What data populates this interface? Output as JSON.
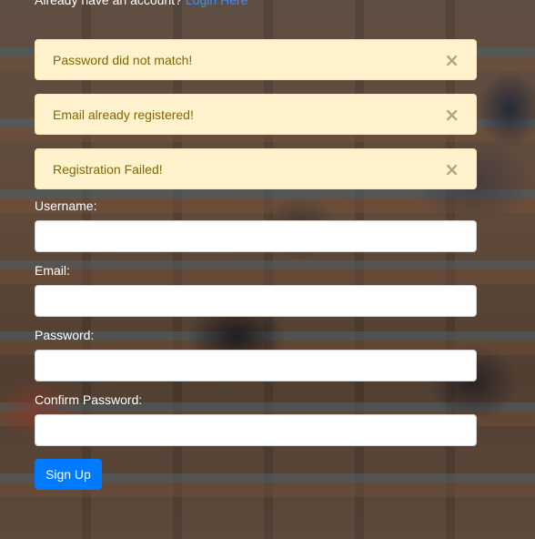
{
  "top_line": {
    "text": "Already have an account?",
    "link": "Login Here"
  },
  "alerts": [
    {
      "message": "Password did not match!",
      "close": "×"
    },
    {
      "message": "Email already registered!",
      "close": "×"
    },
    {
      "message": "Registration Failed!",
      "close": "×"
    }
  ],
  "form": {
    "username_label": "Username:",
    "email_label": "Email:",
    "password_label": "Password:",
    "confirm_label": "Confirm Password:",
    "username_value": "",
    "email_value": "",
    "password_value": "",
    "confirm_value": "",
    "submit_label": "Sign Up"
  },
  "colors": {
    "alert_bg": "#fff3cd",
    "alert_text": "#856404",
    "button_bg": "#007bff",
    "link": "#3d8bfd"
  }
}
